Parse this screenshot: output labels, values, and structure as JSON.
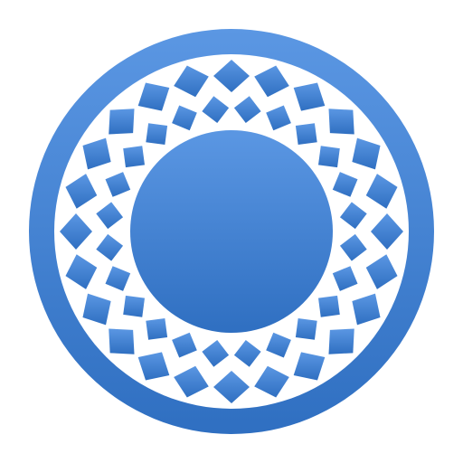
{
  "icon": {
    "name": "rosette-app-icon",
    "colors": {
      "background": "#ffffff",
      "gradient_top": "#5b97e3",
      "gradient_bottom": "#2f6fc1",
      "lattice": "#ffffff"
    },
    "pattern": {
      "outer_tile_count": 24,
      "inner_tile_count": 24
    }
  }
}
